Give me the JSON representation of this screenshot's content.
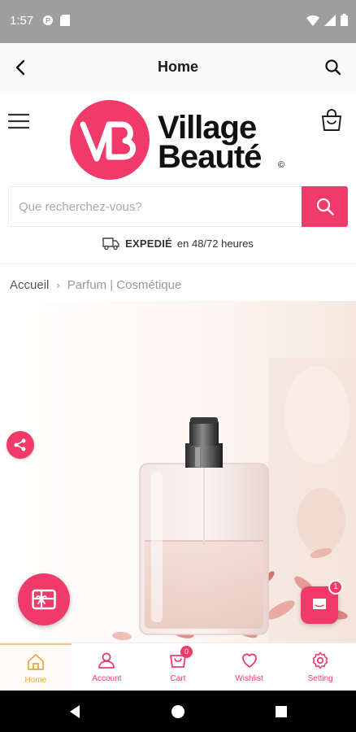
{
  "status_bar": {
    "time": "1:57"
  },
  "app_bar": {
    "title": "Home"
  },
  "logo": {
    "word1": "Village",
    "word2": "Beauté",
    "mark": "©"
  },
  "search": {
    "placeholder": "Que recherchez-vous?",
    "value": ""
  },
  "shipping": {
    "strong": "EXPEDIÉ",
    "text": "en 48/72 heures"
  },
  "breadcrumb": {
    "home": "Accueil",
    "separator": "›",
    "current": "Parfum | Cosmétique"
  },
  "chat": {
    "badge": "1"
  },
  "bottom_nav": {
    "items": [
      {
        "label": "Home",
        "icon": "home-icon",
        "active": true
      },
      {
        "label": "Account",
        "icon": "user-icon"
      },
      {
        "label": "Cart",
        "icon": "cart-icon",
        "badge": "0"
      },
      {
        "label": "Wishlist",
        "icon": "heart-icon"
      },
      {
        "label": "Setting",
        "icon": "gear-icon"
      }
    ]
  },
  "colors": {
    "brand": "#ef3a6a",
    "active_nav": "#e8a948",
    "status_bar": "#9e9e9e"
  }
}
